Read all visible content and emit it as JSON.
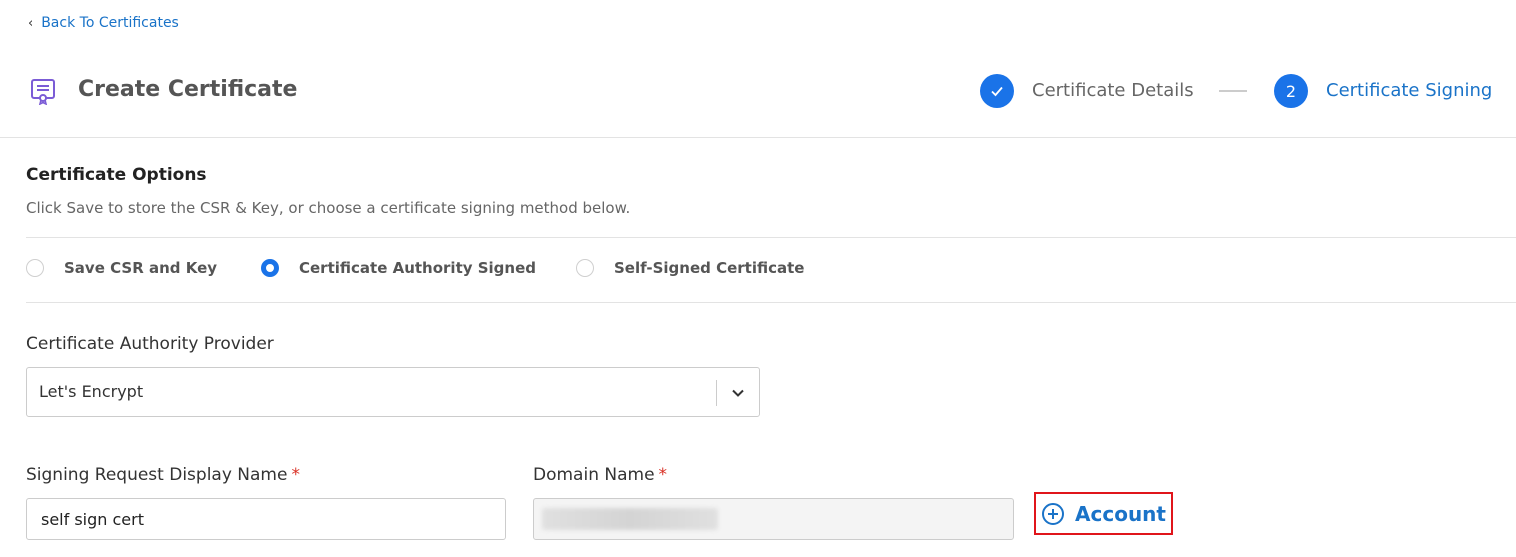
{
  "back_link": {
    "label": "Back To Certificates"
  },
  "header": {
    "title": "Create Certificate"
  },
  "stepper": {
    "steps": [
      {
        "number": "1",
        "label": "Certificate Details",
        "status": "completed"
      },
      {
        "number": "2",
        "label": "Certificate Signing",
        "status": "active"
      }
    ]
  },
  "options": {
    "title": "Certificate Options",
    "description": "Click Save to store the CSR & Key, or choose a certificate signing method below.",
    "radios": [
      {
        "label": "Save CSR and Key",
        "checked": false
      },
      {
        "label": "Certificate Authority Signed",
        "checked": true
      },
      {
        "label": "Self-Signed Certificate",
        "checked": false
      }
    ]
  },
  "ca_provider": {
    "label": "Certificate Authority Provider",
    "value": "Let's Encrypt"
  },
  "signing_request": {
    "label": "Signing Request Display Name",
    "required_marker": "*",
    "value": "self sign cert"
  },
  "domain": {
    "label": "Domain Name",
    "required_marker": "*",
    "value": ""
  },
  "account_button": {
    "label": "Account"
  },
  "colors": {
    "accent": "#1a73e8",
    "link": "#1a73c8",
    "required": "#d93025",
    "highlight_border": "#e0151b"
  }
}
